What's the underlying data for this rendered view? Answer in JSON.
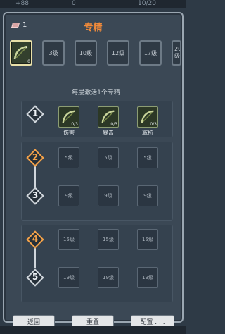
{
  "status_bar": {
    "value1": "+88",
    "value2": "0",
    "value3": "10/20"
  },
  "header": {
    "points": "1",
    "title": "专精"
  },
  "tabs": [
    {
      "label": "",
      "level": "0",
      "selected": true
    },
    {
      "label": "3级",
      "selected": false
    },
    {
      "label": "10级",
      "selected": false
    },
    {
      "label": "12级",
      "selected": false
    },
    {
      "label": "17级",
      "selected": false
    },
    {
      "label": "20级",
      "selected": false
    }
  ],
  "subtitle": "每层激活1个专精",
  "tiers": [
    {
      "number": "1",
      "active": false,
      "slots": [
        {
          "label": "伤害",
          "count": "0/3",
          "filled": true
        },
        {
          "label": "暴击",
          "count": "0/3",
          "filled": true
        },
        {
          "label": "减抗",
          "count": "0/3",
          "filled": true
        }
      ]
    },
    {
      "number": "2",
      "active": true,
      "slots": [
        {
          "label": "5级"
        },
        {
          "label": "5级"
        },
        {
          "label": "5级"
        }
      ]
    },
    {
      "number": "3",
      "active": false,
      "slots": [
        {
          "label": "9级"
        },
        {
          "label": "9级"
        },
        {
          "label": "9级"
        }
      ]
    },
    {
      "number": "4",
      "active": true,
      "slots": [
        {
          "label": "15级"
        },
        {
          "label": "15级"
        },
        {
          "label": "15级"
        }
      ]
    },
    {
      "number": "5",
      "active": false,
      "slots": [
        {
          "label": "19级"
        },
        {
          "label": "19级"
        },
        {
          "label": "19级"
        }
      ]
    }
  ],
  "buttons": {
    "back": "返回",
    "reset": "重置",
    "config": "配置 . . ."
  }
}
